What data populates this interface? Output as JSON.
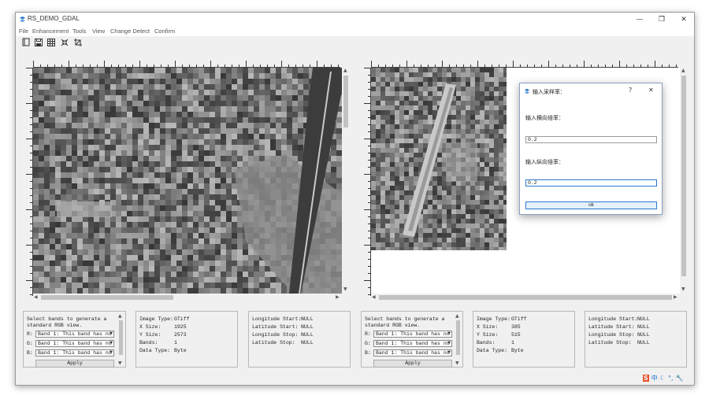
{
  "window": {
    "title": "RS_DEMO_GDAL",
    "controls": {
      "minimize": "—",
      "restore": "❐",
      "close": "✕"
    }
  },
  "menu": [
    "File",
    "Enhancement",
    "Tools",
    "View",
    "Change Detect",
    "Confirm"
  ],
  "toolbar": [
    {
      "icon": "open-file-icon"
    },
    {
      "icon": "save-icon"
    },
    {
      "icon": "grid-icon"
    },
    {
      "icon": "shrink-icon"
    },
    {
      "icon": "crop-icon"
    }
  ],
  "left_panels": {
    "bands": {
      "caption_line1": "Select bands to generate a",
      "caption_line2": "standard RGB view.",
      "r_label": "R:",
      "g_label": "G:",
      "b_label": "B:",
      "r_value": "Band 1: This band has no",
      "g_value": "Band 1: This band has no",
      "b_value": "Band 1: This band has no",
      "apply": "Apply"
    },
    "info": {
      "type_label": "Image Type:",
      "type_value": "GTiff",
      "xsize_label": "X Size:",
      "xsize_value": "1925",
      "ysize_label": "Y Size:",
      "ysize_value": "2573",
      "bands_label": "Bands:",
      "bands_value": "1",
      "dtype_label": "Data Type:",
      "dtype_value": "Byte"
    },
    "geo": {
      "lon_start_label": "Longitude Start:",
      "lon_start": "NULL",
      "lat_start_label": "Latitude Start:",
      "lat_start": "NULL",
      "lon_stop_label": "Longitude Stop:",
      "lon_stop": "NULL",
      "lat_stop_label": "Latitude Stop:",
      "lat_stop": "NULL"
    }
  },
  "right_panels": {
    "bands": {
      "caption_line1": "Select bands to generate a",
      "caption_line2": "standard RGB view.",
      "r_label": "R:",
      "g_label": "G:",
      "b_label": "B:",
      "r_value": "Band 1: This band has no",
      "g_value": "Band 1: This band has no",
      "b_value": "Band 1: This band has no",
      "apply": "Apply"
    },
    "info": {
      "type_label": "Image Type:",
      "type_value": "GTiff",
      "xsize_label": "X Size:",
      "xsize_value": "385",
      "ysize_label": "Y Size:",
      "ysize_value": "515",
      "bands_label": "Bands:",
      "bands_value": "1",
      "dtype_label": "Data Type:",
      "dtype_value": "Byte"
    },
    "geo": {
      "lon_start_label": "Longitude Start:",
      "lon_start": "NULL",
      "lat_start_label": "Latitude Start:",
      "lat_start": "NULL",
      "lon_stop_label": "Longitude Stop:",
      "lon_stop": "NULL",
      "lat_stop_label": "Latitude Stop:",
      "lat_stop": "NULL"
    }
  },
  "dialog": {
    "title": "输入采样率：",
    "help": "?",
    "close": "✕",
    "label_h": "输入横向倍率：",
    "value_h": "0.2",
    "label_v": "输入纵向倍率：",
    "value_v": "0.2",
    "ok": "ok"
  },
  "tray": {
    "ime": "中"
  },
  "colors": {
    "accent": "#2a78d0",
    "panel_border": "#b8b8b8",
    "image_bg": "#5a5a5a"
  }
}
